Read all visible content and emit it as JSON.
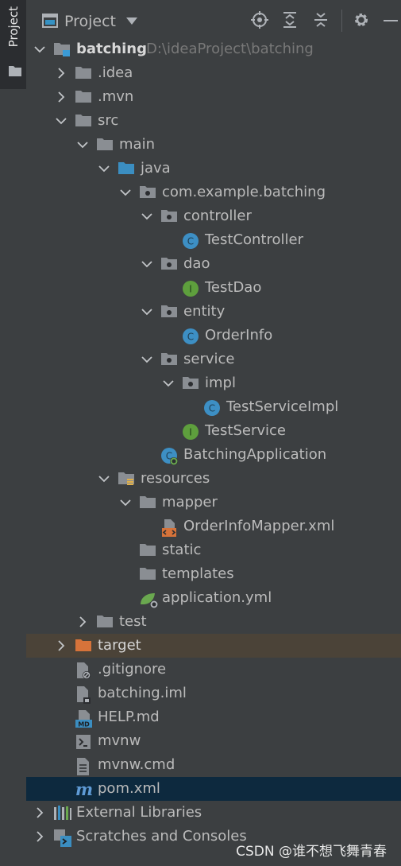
{
  "sidebar": {
    "tab_label": "Project"
  },
  "toolbar": {
    "title": "Project"
  },
  "tree": [
    {
      "label": "batching",
      "hint": "D:\\ideaProject\\batching",
      "depth": 0,
      "expanded": true,
      "icon": "module-folder-icon",
      "bold": true
    },
    {
      "label": ".idea",
      "depth": 1,
      "expanded": false,
      "icon": "folder-icon"
    },
    {
      "label": ".mvn",
      "depth": 1,
      "expanded": false,
      "icon": "folder-icon"
    },
    {
      "label": "src",
      "depth": 1,
      "expanded": true,
      "icon": "folder-icon"
    },
    {
      "label": "main",
      "depth": 2,
      "expanded": true,
      "icon": "folder-icon"
    },
    {
      "label": "java",
      "depth": 3,
      "expanded": true,
      "icon": "source-folder-icon"
    },
    {
      "label": "com.example.batching",
      "depth": 4,
      "expanded": true,
      "icon": "package-icon"
    },
    {
      "label": "controller",
      "depth": 5,
      "expanded": true,
      "icon": "package-icon"
    },
    {
      "label": "TestController",
      "depth": 6,
      "icon": "class-icon"
    },
    {
      "label": "dao",
      "depth": 5,
      "expanded": true,
      "icon": "package-icon"
    },
    {
      "label": "TestDao",
      "depth": 6,
      "icon": "interface-icon"
    },
    {
      "label": "entity",
      "depth": 5,
      "expanded": true,
      "icon": "package-icon"
    },
    {
      "label": "OrderInfo",
      "depth": 6,
      "icon": "class-icon"
    },
    {
      "label": "service",
      "depth": 5,
      "expanded": true,
      "icon": "package-icon"
    },
    {
      "label": "impl",
      "depth": 6,
      "expanded": true,
      "icon": "package-icon"
    },
    {
      "label": "TestServiceImpl",
      "depth": 7,
      "icon": "class-icon"
    },
    {
      "label": "TestService",
      "depth": 6,
      "icon": "interface-icon"
    },
    {
      "label": "BatchingApplication",
      "depth": 5,
      "icon": "spring-boot-class-icon"
    },
    {
      "label": "resources",
      "depth": 3,
      "expanded": true,
      "icon": "resources-folder-icon"
    },
    {
      "label": "mapper",
      "depth": 4,
      "expanded": true,
      "icon": "folder-icon"
    },
    {
      "label": "OrderInfoMapper.xml",
      "depth": 5,
      "icon": "xml-file-icon"
    },
    {
      "label": "static",
      "depth": 4,
      "icon": "folder-icon"
    },
    {
      "label": "templates",
      "depth": 4,
      "icon": "folder-icon"
    },
    {
      "label": "application.yml",
      "depth": 4,
      "icon": "yaml-config-icon"
    },
    {
      "label": "test",
      "depth": 2,
      "expanded": false,
      "icon": "folder-icon"
    },
    {
      "label": "target",
      "depth": 1,
      "expanded": false,
      "icon": "excluded-folder-icon",
      "highlight": "target"
    },
    {
      "label": ".gitignore",
      "depth": 1,
      "icon": "gitignore-file-icon"
    },
    {
      "label": "batching.iml",
      "depth": 1,
      "icon": "iml-file-icon"
    },
    {
      "label": "HELP.md",
      "depth": 1,
      "icon": "markdown-file-icon"
    },
    {
      "label": "mvnw",
      "depth": 1,
      "icon": "shell-script-icon"
    },
    {
      "label": "mvnw.cmd",
      "depth": 1,
      "icon": "text-file-icon"
    },
    {
      "label": "pom.xml",
      "depth": 1,
      "icon": "maven-icon",
      "highlight": "pom"
    },
    {
      "label": "External Libraries",
      "depth": 0,
      "expanded": false,
      "icon": "libraries-icon"
    },
    {
      "label": "Scratches and Consoles",
      "depth": 0,
      "expanded": false,
      "icon": "scratches-icon"
    }
  ],
  "watermark": "CSDN @谁不想飞舞青春",
  "colors": {
    "background": "#3c3f41",
    "class": "#3d8fc4",
    "interface": "#5e9f3d",
    "folder": "#8a8e93",
    "source_folder": "#3b8ec1",
    "excluded": "#d6733a",
    "selection": "#0d293e",
    "target_row": "#4b4338"
  }
}
